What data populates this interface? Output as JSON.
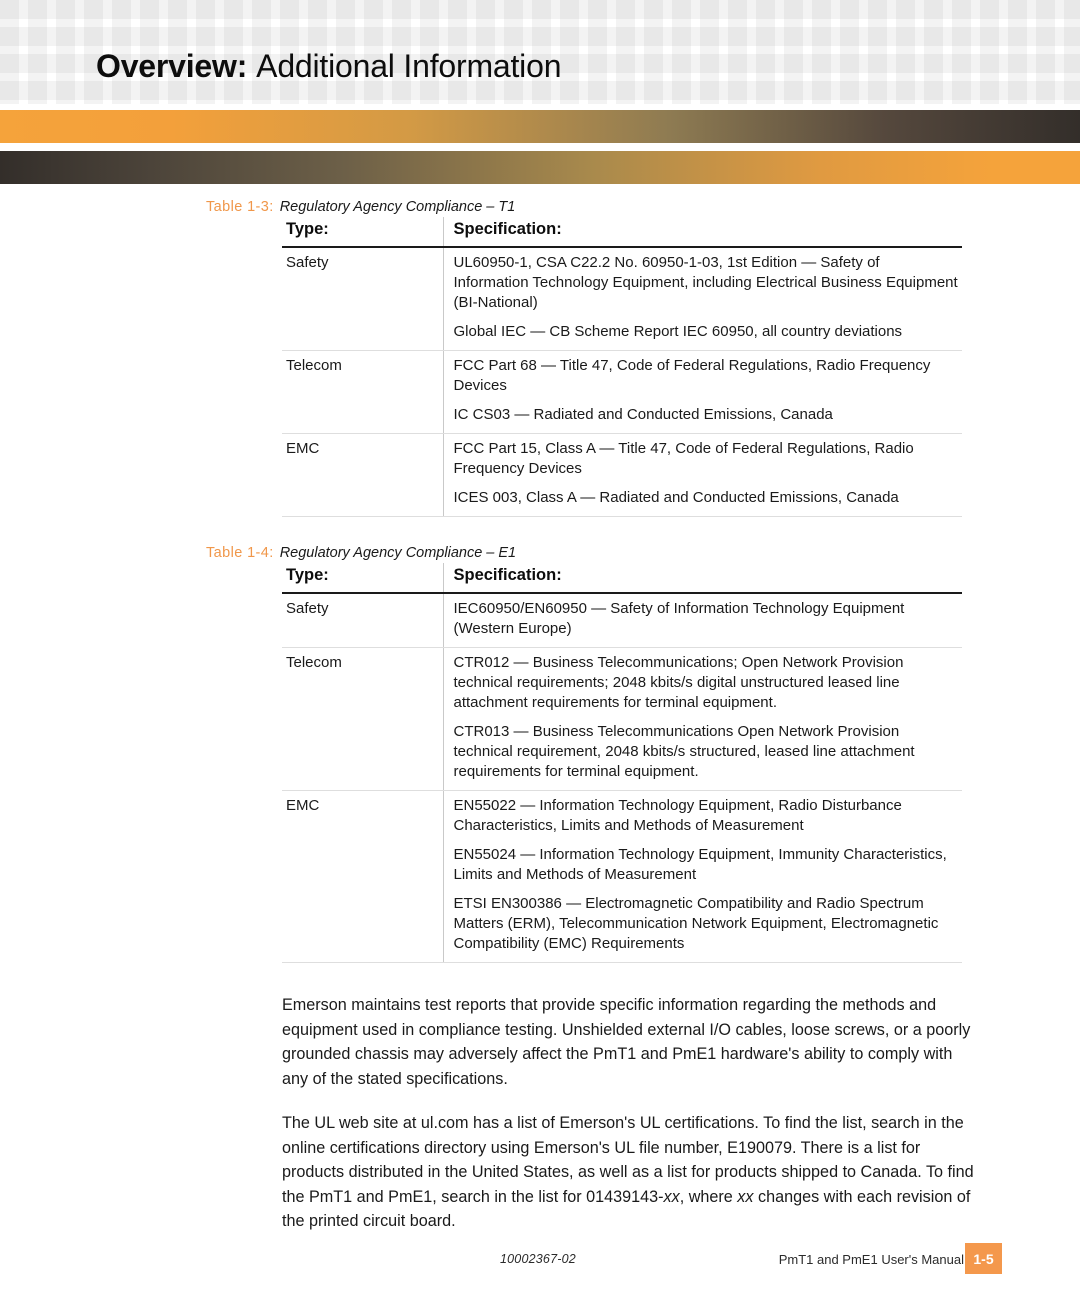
{
  "header": {
    "title_bold": "Overview:",
    "title_regular": "Additional Information"
  },
  "theme": {
    "accent_orange": "#F4984C",
    "band_orange": "#F5A33B",
    "band_dark": "#332E2A",
    "caption_orange": "#F0974A",
    "pattern_gray": "#F3F3F3"
  },
  "tables": [
    {
      "caption_label": "Table 1-3:",
      "caption_text": "Regulatory Agency Compliance – T1",
      "columns": [
        "Type:",
        "Specification:"
      ],
      "rows": [
        {
          "type": "Safety",
          "specs": [
            "UL60950-1, CSA C22.2 No. 60950-1-03, 1st Edition — Safety of Information Technology Equipment, including Electrical Business Equipment (BI-National)",
            "Global IEC — CB Scheme Report IEC 60950, all country deviations"
          ]
        },
        {
          "type": "Telecom",
          "specs": [
            "FCC Part 68 — Title 47, Code of Federal Regulations, Radio Frequency Devices",
            "IC CS03 — Radiated and Conducted Emissions, Canada"
          ]
        },
        {
          "type": "EMC",
          "specs": [
            "FCC Part 15, Class A — Title 47, Code of Federal Regulations, Radio Frequency Devices",
            "ICES 003, Class A — Radiated and Conducted Emissions, Canada"
          ]
        }
      ]
    },
    {
      "caption_label": "Table 1-4:",
      "caption_text": "Regulatory Agency Compliance – E1",
      "columns": [
        "Type:",
        "Specification:"
      ],
      "rows": [
        {
          "type": "Safety",
          "specs": [
            "IEC60950/EN60950 — Safety of Information Technology Equipment (Western Europe)"
          ]
        },
        {
          "type": "Telecom",
          "specs": [
            "CTR012 — Business Telecommunications; Open Network Provision technical requirements; 2048 kbits/s digital unstructured leased line attachment requirements for terminal equipment.",
            "CTR013 — Business Telecommunications Open Network Provision technical requirement, 2048 kbits/s structured, leased line attachment requirements for terminal equipment."
          ]
        },
        {
          "type": "EMC",
          "specs": [
            "EN55022 — Information Technology Equipment, Radio Disturbance Characteristics, Limits and Methods of Measurement",
            "EN55024 — Information Technology Equipment, Immunity Characteristics, Limits and Methods of Measurement",
            "ETSI EN300386 — Electromagnetic Compatibility and Radio Spectrum Matters (ERM), Telecommunication Network Equipment, Electromagnetic Compatibility (EMC) Requirements"
          ]
        }
      ]
    }
  ],
  "paragraphs": {
    "p1": "Emerson maintains test reports that provide specific information regarding the methods and equipment used in compliance testing. Unshielded external I/O cables, loose screws, or a poorly grounded chassis may adversely affect the PmT1 and PmE1 hardware's ability to comply with any of the stated specifications.",
    "p2_part1": "The UL web site at ul.com has a list of Emerson's UL certifications. To find the list, search in the online certifications directory using Emerson's UL file number, E190079. There is a list for products distributed in the United States, as well as a list for products shipped to Canada. To find the PmT1 and PmE1, search in the list for 01439143-",
    "p2_italic1": "xx",
    "p2_part2": ", where ",
    "p2_italic2": "xx",
    "p2_part3": " changes with each revision of the printed circuit board."
  },
  "footer": {
    "document_number": "10002367-02",
    "manual_title": "PmT1 and PmE1 User's Manual",
    "page_number": "1-5"
  }
}
